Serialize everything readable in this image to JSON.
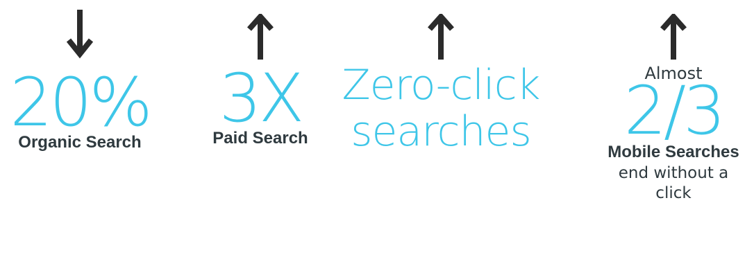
{
  "colors": {
    "accent": "#3ec6e8",
    "text": "#2f3a3f",
    "arrow": "#2b2b2b"
  },
  "stats": [
    {
      "direction": "down",
      "icon": "arrow-down-icon",
      "value": "20%",
      "label": "Organic Search"
    },
    {
      "direction": "up",
      "icon": "arrow-up-icon",
      "value": "3X",
      "label": "Paid Search"
    },
    {
      "direction": "up",
      "icon": "arrow-up-icon",
      "value_line1": "Zero-click",
      "value_line2": "searches"
    },
    {
      "direction": "up",
      "icon": "arrow-up-icon",
      "prefix": "Almost",
      "value": "2/3",
      "label": "Mobile Searches",
      "suffix": "end without a click"
    }
  ]
}
